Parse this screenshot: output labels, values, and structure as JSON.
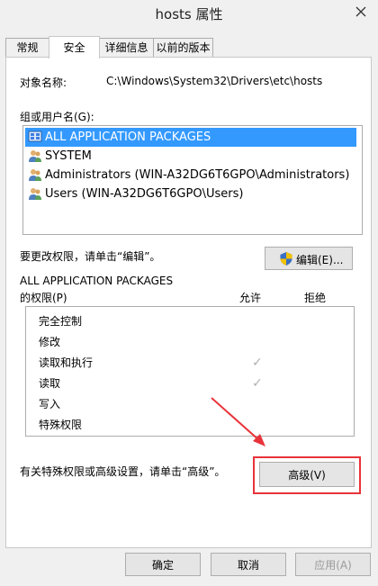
{
  "window": {
    "title": "hosts 属性",
    "close_label": "✕"
  },
  "tabs": [
    {
      "label": "常规",
      "active": false
    },
    {
      "label": "安全",
      "active": true
    },
    {
      "label": "详细信息",
      "active": false
    },
    {
      "label": "以前的版本",
      "active": false
    }
  ],
  "object": {
    "label": "对象名称:",
    "value": "C:\\Windows\\System32\\Drivers\\etc\\hosts"
  },
  "groups": {
    "label": "组或用户名(G):",
    "items": [
      {
        "name": "ALL APPLICATION PACKAGES",
        "selected": true,
        "icon": "app-packages-icon"
      },
      {
        "name": "SYSTEM",
        "selected": false,
        "icon": "users-group-icon"
      },
      {
        "name": "Administrators (WIN-A32DG6T6GPO\\Administrators)",
        "selected": false,
        "icon": "users-group-icon"
      },
      {
        "name": "Users (WIN-A32DG6T6GPO\\Users)",
        "selected": false,
        "icon": "users-group-icon"
      }
    ]
  },
  "edit": {
    "hint": "要更改权限，请单击“编辑”。",
    "button_label": "编辑(E)...",
    "icon": "uac-shield-icon"
  },
  "permissions": {
    "title_line1": "ALL APPLICATION PACKAGES",
    "title_line2": "的权限(P)",
    "allow_label": "允许",
    "deny_label": "拒绝",
    "items": [
      {
        "name": "完全控制",
        "allow": false,
        "deny": false
      },
      {
        "name": "修改",
        "allow": false,
        "deny": false
      },
      {
        "name": "读取和执行",
        "allow": true,
        "deny": false
      },
      {
        "name": "读取",
        "allow": true,
        "deny": false
      },
      {
        "name": "写入",
        "allow": false,
        "deny": false
      },
      {
        "name": "特殊权限",
        "allow": false,
        "deny": false
      }
    ]
  },
  "advanced": {
    "hint": "有关特殊权限或高级设置，请单击“高级”。",
    "button_label": "高级(V)"
  },
  "footer": {
    "ok_label": "确定",
    "cancel_label": "取消",
    "apply_label": "应用(A)"
  },
  "annotation": {
    "highlight_color": "#e8333a"
  }
}
